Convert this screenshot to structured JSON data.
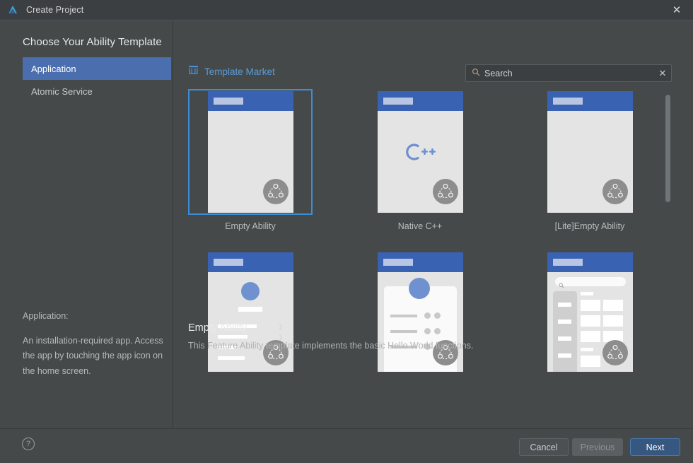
{
  "window": {
    "title": "Create Project",
    "logo_icon": "deveco-logo-icon",
    "close_icon": "close-icon"
  },
  "left_pane": {
    "heading": "Choose Your Ability Template",
    "categories": [
      {
        "label": "Application",
        "selected": true
      },
      {
        "label": "Atomic Service",
        "selected": false
      }
    ],
    "description_label": "Application:",
    "description_text": "An installation-required app. Access the app by touching the app icon on the home screen."
  },
  "right_pane": {
    "market_link": {
      "label": "Template Market",
      "icon": "store-icon",
      "color": "#5a9bd8"
    },
    "search": {
      "placeholder": "Search",
      "value": "",
      "search_icon": "search-icon",
      "clear_icon": "clear-icon"
    },
    "templates": [
      {
        "caption": "Empty Ability",
        "selected": true,
        "thumb": "empty"
      },
      {
        "caption": "Native C++",
        "selected": false,
        "thumb": "cpp"
      },
      {
        "caption": "[Lite]Empty Ability",
        "selected": false,
        "thumb": "empty"
      },
      {
        "caption": "",
        "selected": false,
        "thumb": "list"
      },
      {
        "caption": "",
        "selected": false,
        "thumb": "card"
      },
      {
        "caption": "",
        "selected": false,
        "thumb": "grid"
      }
    ],
    "selection": {
      "title": "Empty Ability",
      "description": "This Feature Ability template implements the basic Hello World functions."
    },
    "scrollbar": {
      "visible": true
    }
  },
  "footer": {
    "help_icon": "help-icon",
    "buttons": [
      {
        "label": "Cancel",
        "style": "default",
        "disabled": false
      },
      {
        "label": "Previous",
        "style": "disabled",
        "disabled": true
      },
      {
        "label": "Next",
        "style": "primary",
        "disabled": false
      }
    ]
  },
  "colors": {
    "accent": "#4b6eaf",
    "primary_button": "#365880",
    "link": "#5a9bd8",
    "selection_border": "#3c8cd8",
    "window_bg": "#45494a",
    "titlebar_bg": "#3c3f41"
  }
}
